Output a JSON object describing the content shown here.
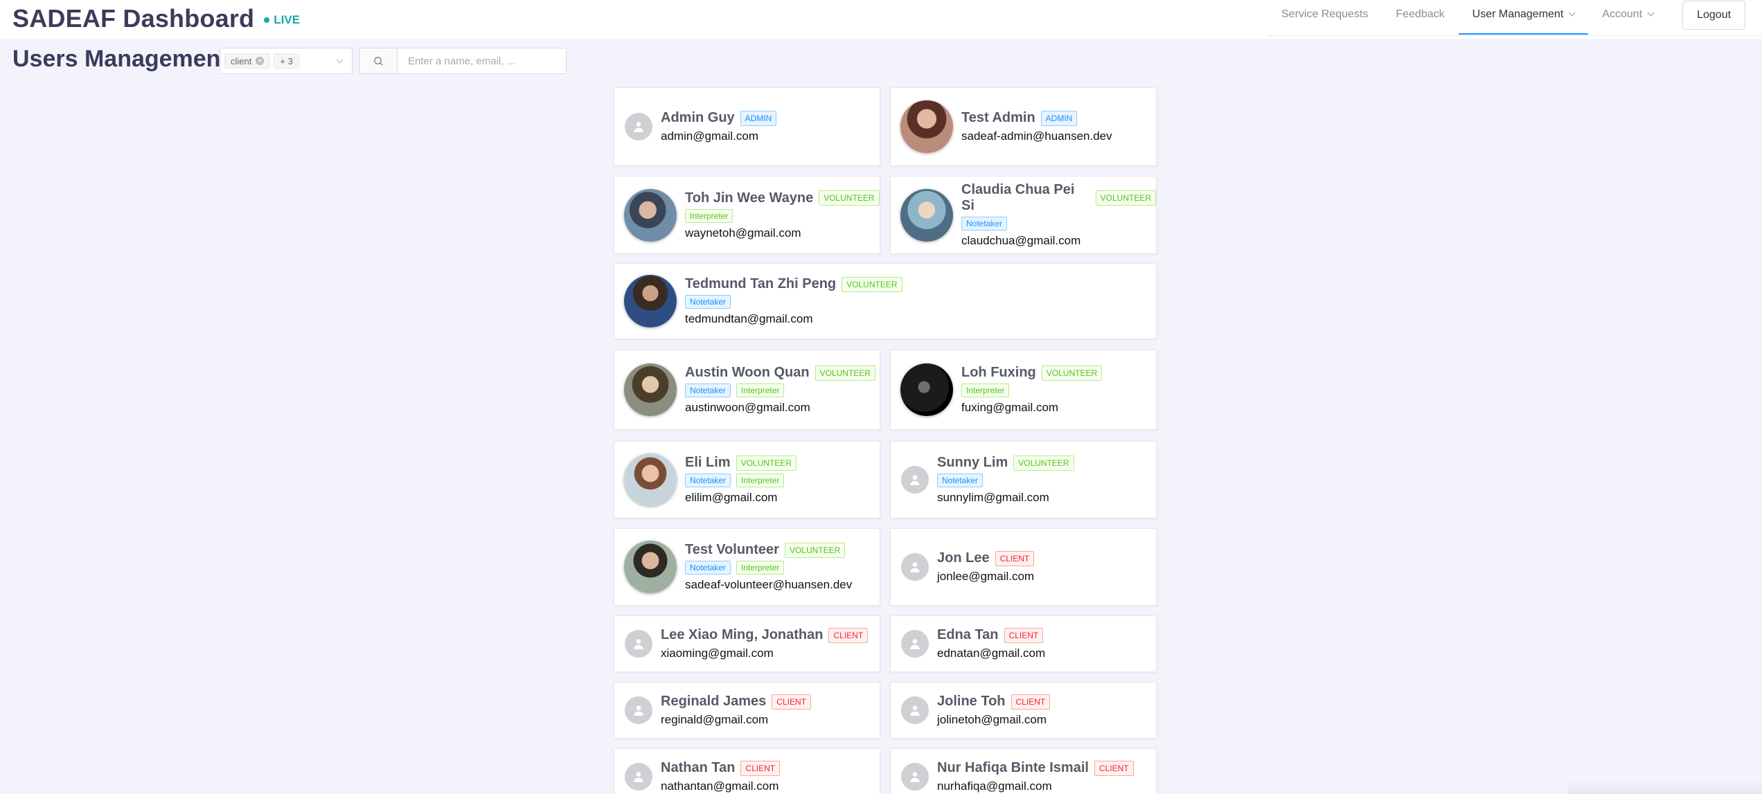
{
  "app": {
    "title": "SADEAF Dashboard",
    "live": "LIVE"
  },
  "nav": {
    "items": [
      "Service Requests",
      "Feedback",
      "User Management",
      "Account"
    ],
    "logout": "Logout"
  },
  "toolbar": {
    "page_title": "Users Management",
    "filter_tag": "client",
    "filter_more": "+ 3",
    "search_placeholder": "Enter a name, email, ..."
  },
  "users": [
    {
      "name": "Admin Guy",
      "role": "ADMIN",
      "skills": [],
      "email": "admin@gmail.com",
      "avatar": "default"
    },
    {
      "name": "Test Admin",
      "role": "ADMIN",
      "skills": [],
      "email": "sadeaf-admin@huansen.dev",
      "avatar": "photo"
    },
    {
      "name": "Toh Jin Wee Wayne",
      "role": "VOLUNTEER",
      "skills": [
        "Interpreter"
      ],
      "email": "waynetoh@gmail.com",
      "avatar": "photo"
    },
    {
      "name": "Claudia Chua Pei Si",
      "role": "VOLUNTEER",
      "skills": [
        "Notetaker"
      ],
      "email": "claudchua@gmail.com",
      "avatar": "photo"
    },
    {
      "name": "Tedmund Tan Zhi Peng",
      "role": "VOLUNTEER",
      "skills": [
        "Notetaker"
      ],
      "email": "tedmundtan@gmail.com",
      "avatar": "photo"
    },
    {
      "name": "Austin Woon Quan",
      "role": "VOLUNTEER",
      "skills": [
        "Notetaker",
        "Interpreter"
      ],
      "email": "austinwoon@gmail.com",
      "avatar": "photo"
    },
    {
      "name": "Loh Fuxing",
      "role": "VOLUNTEER",
      "skills": [
        "Interpreter"
      ],
      "email": "fuxing@gmail.com",
      "avatar": "photo"
    },
    {
      "name": "Eli Lim",
      "role": "VOLUNTEER",
      "skills": [
        "Notetaker",
        "Interpreter"
      ],
      "email": "elilim@gmail.com",
      "avatar": "photo"
    },
    {
      "name": "Sunny Lim",
      "role": "VOLUNTEER",
      "skills": [
        "Notetaker"
      ],
      "email": "sunnylim@gmail.com",
      "avatar": "default"
    },
    {
      "name": "Test Volunteer",
      "role": "VOLUNTEER",
      "skills": [
        "Notetaker",
        "Interpreter"
      ],
      "email": "sadeaf-volunteer@huansen.dev",
      "avatar": "photo"
    },
    {
      "name": "Jon Lee",
      "role": "CLIENT",
      "skills": [],
      "email": "jonlee@gmail.com",
      "avatar": "default"
    },
    {
      "name": "Lee Xiao Ming, Jonathan",
      "role": "CLIENT",
      "skills": [],
      "email": "xiaoming@gmail.com",
      "avatar": "default"
    },
    {
      "name": "Edna Tan",
      "role": "CLIENT",
      "skills": [],
      "email": "ednatan@gmail.com",
      "avatar": "default"
    },
    {
      "name": "Reginald James",
      "role": "CLIENT",
      "skills": [],
      "email": "reginald@gmail.com",
      "avatar": "default"
    },
    {
      "name": "Joline Toh",
      "role": "CLIENT",
      "skills": [],
      "email": "jolinetoh@gmail.com",
      "avatar": "default"
    },
    {
      "name": "Nathan Tan",
      "role": "CLIENT",
      "skills": [],
      "email": "nathantan@gmail.com",
      "avatar": "default"
    },
    {
      "name": "Nur Hafiqa Binte Ismail",
      "role": "CLIENT",
      "skills": [],
      "email": "nurhafiqa@gmail.com",
      "avatar": "default"
    }
  ],
  "colors": {
    "accent": "#1890ff",
    "live": "#13a8a8",
    "admin": "#1890ff",
    "volunteer": "#52c41a",
    "client": "#f5222d"
  }
}
